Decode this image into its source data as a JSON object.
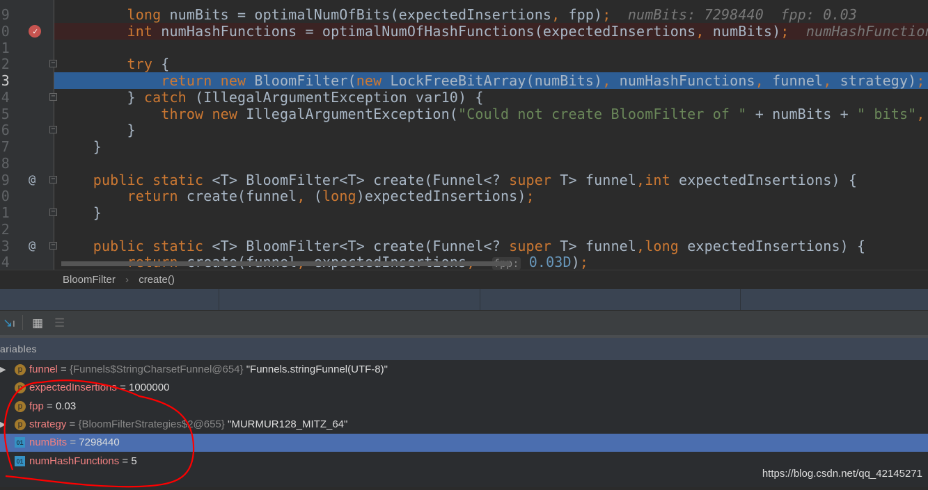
{
  "editor": {
    "lines": [
      {
        "num": "9",
        "tokens": [
          [
            "",
            "        "
          ],
          [
            "kw",
            "long"
          ],
          [
            "",
            " numBits = optimalNumOfBits(expectedInsertions"
          ],
          [
            "kw",
            ","
          ],
          [
            "",
            " fpp)"
          ],
          [
            "kw",
            ";"
          ],
          [
            "hint",
            "  numBits: 7298440  fpp: 0.03"
          ]
        ]
      },
      {
        "num": "0",
        "state": "breakpoint",
        "tokens": [
          [
            "",
            "        "
          ],
          [
            "kw",
            "int"
          ],
          [
            "",
            " numHashFunctions = optimalNumOfHashFunctions(expectedInsertions"
          ],
          [
            "kw",
            ","
          ],
          [
            "",
            " numBits)"
          ],
          [
            "kw",
            ";"
          ],
          [
            "hint",
            "  numHashFunctions"
          ]
        ]
      },
      {
        "num": "1",
        "tokens": []
      },
      {
        "num": "2",
        "fold": true,
        "tokens": [
          [
            "",
            "        "
          ],
          [
            "kw",
            "try"
          ],
          [
            "",
            " {"
          ]
        ]
      },
      {
        "num": "3",
        "state": "current",
        "tokens": [
          [
            "",
            "            "
          ],
          [
            "kw",
            "return new"
          ],
          [
            "",
            " BloomFilter("
          ],
          [
            "kw",
            "new"
          ],
          [
            "",
            " LockFreeBitArray(numBits)"
          ],
          [
            "kw",
            ","
          ],
          [
            "",
            " numHashFunctions"
          ],
          [
            "kw",
            ","
          ],
          [
            "",
            " funnel"
          ],
          [
            "kw",
            ","
          ],
          [
            "",
            " strategy)"
          ],
          [
            "kw",
            ";"
          ]
        ]
      },
      {
        "num": "4",
        "fold": true,
        "tokens": [
          [
            "",
            "        } "
          ],
          [
            "kw",
            "catch"
          ],
          [
            "",
            " (IllegalArgumentException var10) {"
          ]
        ]
      },
      {
        "num": "5",
        "tokens": [
          [
            "",
            "            "
          ],
          [
            "kw",
            "throw new"
          ],
          [
            "",
            " IllegalArgumentException("
          ],
          [
            "str",
            "\"Could not create BloomFilter of \""
          ],
          [
            "",
            " + numBits + "
          ],
          [
            "str",
            "\" bits\""
          ],
          [
            "kw",
            ","
          ],
          [
            "",
            " v"
          ]
        ]
      },
      {
        "num": "6",
        "fold": true,
        "tokens": [
          [
            "",
            "        }"
          ]
        ]
      },
      {
        "num": "7",
        "tokens": [
          [
            "",
            "    }"
          ]
        ]
      },
      {
        "num": "8",
        "tokens": []
      },
      {
        "num": "9",
        "marker": "@",
        "fold": true,
        "tokens": [
          [
            "",
            "    "
          ],
          [
            "kw",
            "public static"
          ],
          [
            "",
            " <T> BloomFilter<T> create(Funnel<? "
          ],
          [
            "kw",
            "super"
          ],
          [
            "",
            " T> funnel"
          ],
          [
            "kw",
            ","
          ],
          [
            " "
          ],
          [
            "kw",
            "int"
          ],
          [
            "",
            " expectedInsertions) {"
          ]
        ]
      },
      {
        "num": "0",
        "tokens": [
          [
            "",
            "        "
          ],
          [
            "kw",
            "return"
          ],
          [
            "",
            " create(funnel"
          ],
          [
            "kw",
            ","
          ],
          [
            "",
            " ("
          ],
          [
            "kw",
            "long"
          ],
          [
            "",
            ")expectedInsertions)"
          ],
          [
            "kw",
            ";"
          ]
        ]
      },
      {
        "num": "1",
        "fold": true,
        "tokens": [
          [
            "",
            "    }"
          ]
        ]
      },
      {
        "num": "2",
        "tokens": []
      },
      {
        "num": "3",
        "marker": "@",
        "fold": true,
        "tokens": [
          [
            "",
            "    "
          ],
          [
            "kw",
            "public static"
          ],
          [
            "",
            " <T> BloomFilter<T> create(Funnel<? "
          ],
          [
            "kw",
            "super"
          ],
          [
            "",
            " T> funnel"
          ],
          [
            "kw",
            ","
          ],
          [
            " "
          ],
          [
            "kw",
            "long"
          ],
          [
            "",
            " expectedInsertions) {"
          ]
        ]
      },
      {
        "num": "4",
        "tokens": [
          [
            "",
            "        "
          ],
          [
            "kw",
            "return"
          ],
          [
            "",
            " create(funnel"
          ],
          [
            "kw",
            ","
          ],
          [
            "",
            " expectedInsertions"
          ],
          [
            "kw",
            ","
          ],
          [
            "",
            "  "
          ],
          [
            "phint",
            "fpp:"
          ],
          [
            "num2",
            " 0.03D"
          ],
          [
            "",
            ")"
          ],
          [
            "kw",
            ";"
          ]
        ]
      }
    ]
  },
  "breadcrumb": {
    "items": [
      "BloomFilter",
      "create()"
    ],
    "separator": "›"
  },
  "toolbar": {
    "icons": [
      "restore-layout-icon",
      "evaluate-expression-icon",
      "watches-icon"
    ]
  },
  "variables": {
    "title": "ariables",
    "items": [
      {
        "name": "funnel",
        "eq": " = ",
        "type": "{Funnels$StringCharsetFunnel@654}",
        "value": " \"Funnels.stringFunnel(UTF-8)\"",
        "kind": "p",
        "expandable": true
      },
      {
        "name": "expectedInsertions",
        "eq": " = ",
        "type": "",
        "value": "1000000",
        "kind": "p"
      },
      {
        "name": "fpp",
        "eq": " = ",
        "type": "",
        "value": "0.03",
        "kind": "p"
      },
      {
        "name": "strategy",
        "eq": " = ",
        "type": "{BloomFilterStrategies$2@655}",
        "value": " \"MURMUR128_MITZ_64\"",
        "kind": "p",
        "expandable": true
      },
      {
        "name": "numBits",
        "eq": " = ",
        "type": "",
        "value": "7298440",
        "kind": "01",
        "selected": true
      },
      {
        "name": "numHashFunctions",
        "eq": " = ",
        "type": "",
        "value": "5",
        "kind": "01"
      }
    ]
  },
  "watermark": "https://blog.csdn.net/qq_42145271",
  "colors": {
    "keyword": "#cc7832",
    "string": "#6a8759",
    "current_line": "#2d5e96",
    "breakpoint_line": "#3b2323",
    "selection": "#4b6eaf",
    "annotation": "#ff0000"
  }
}
